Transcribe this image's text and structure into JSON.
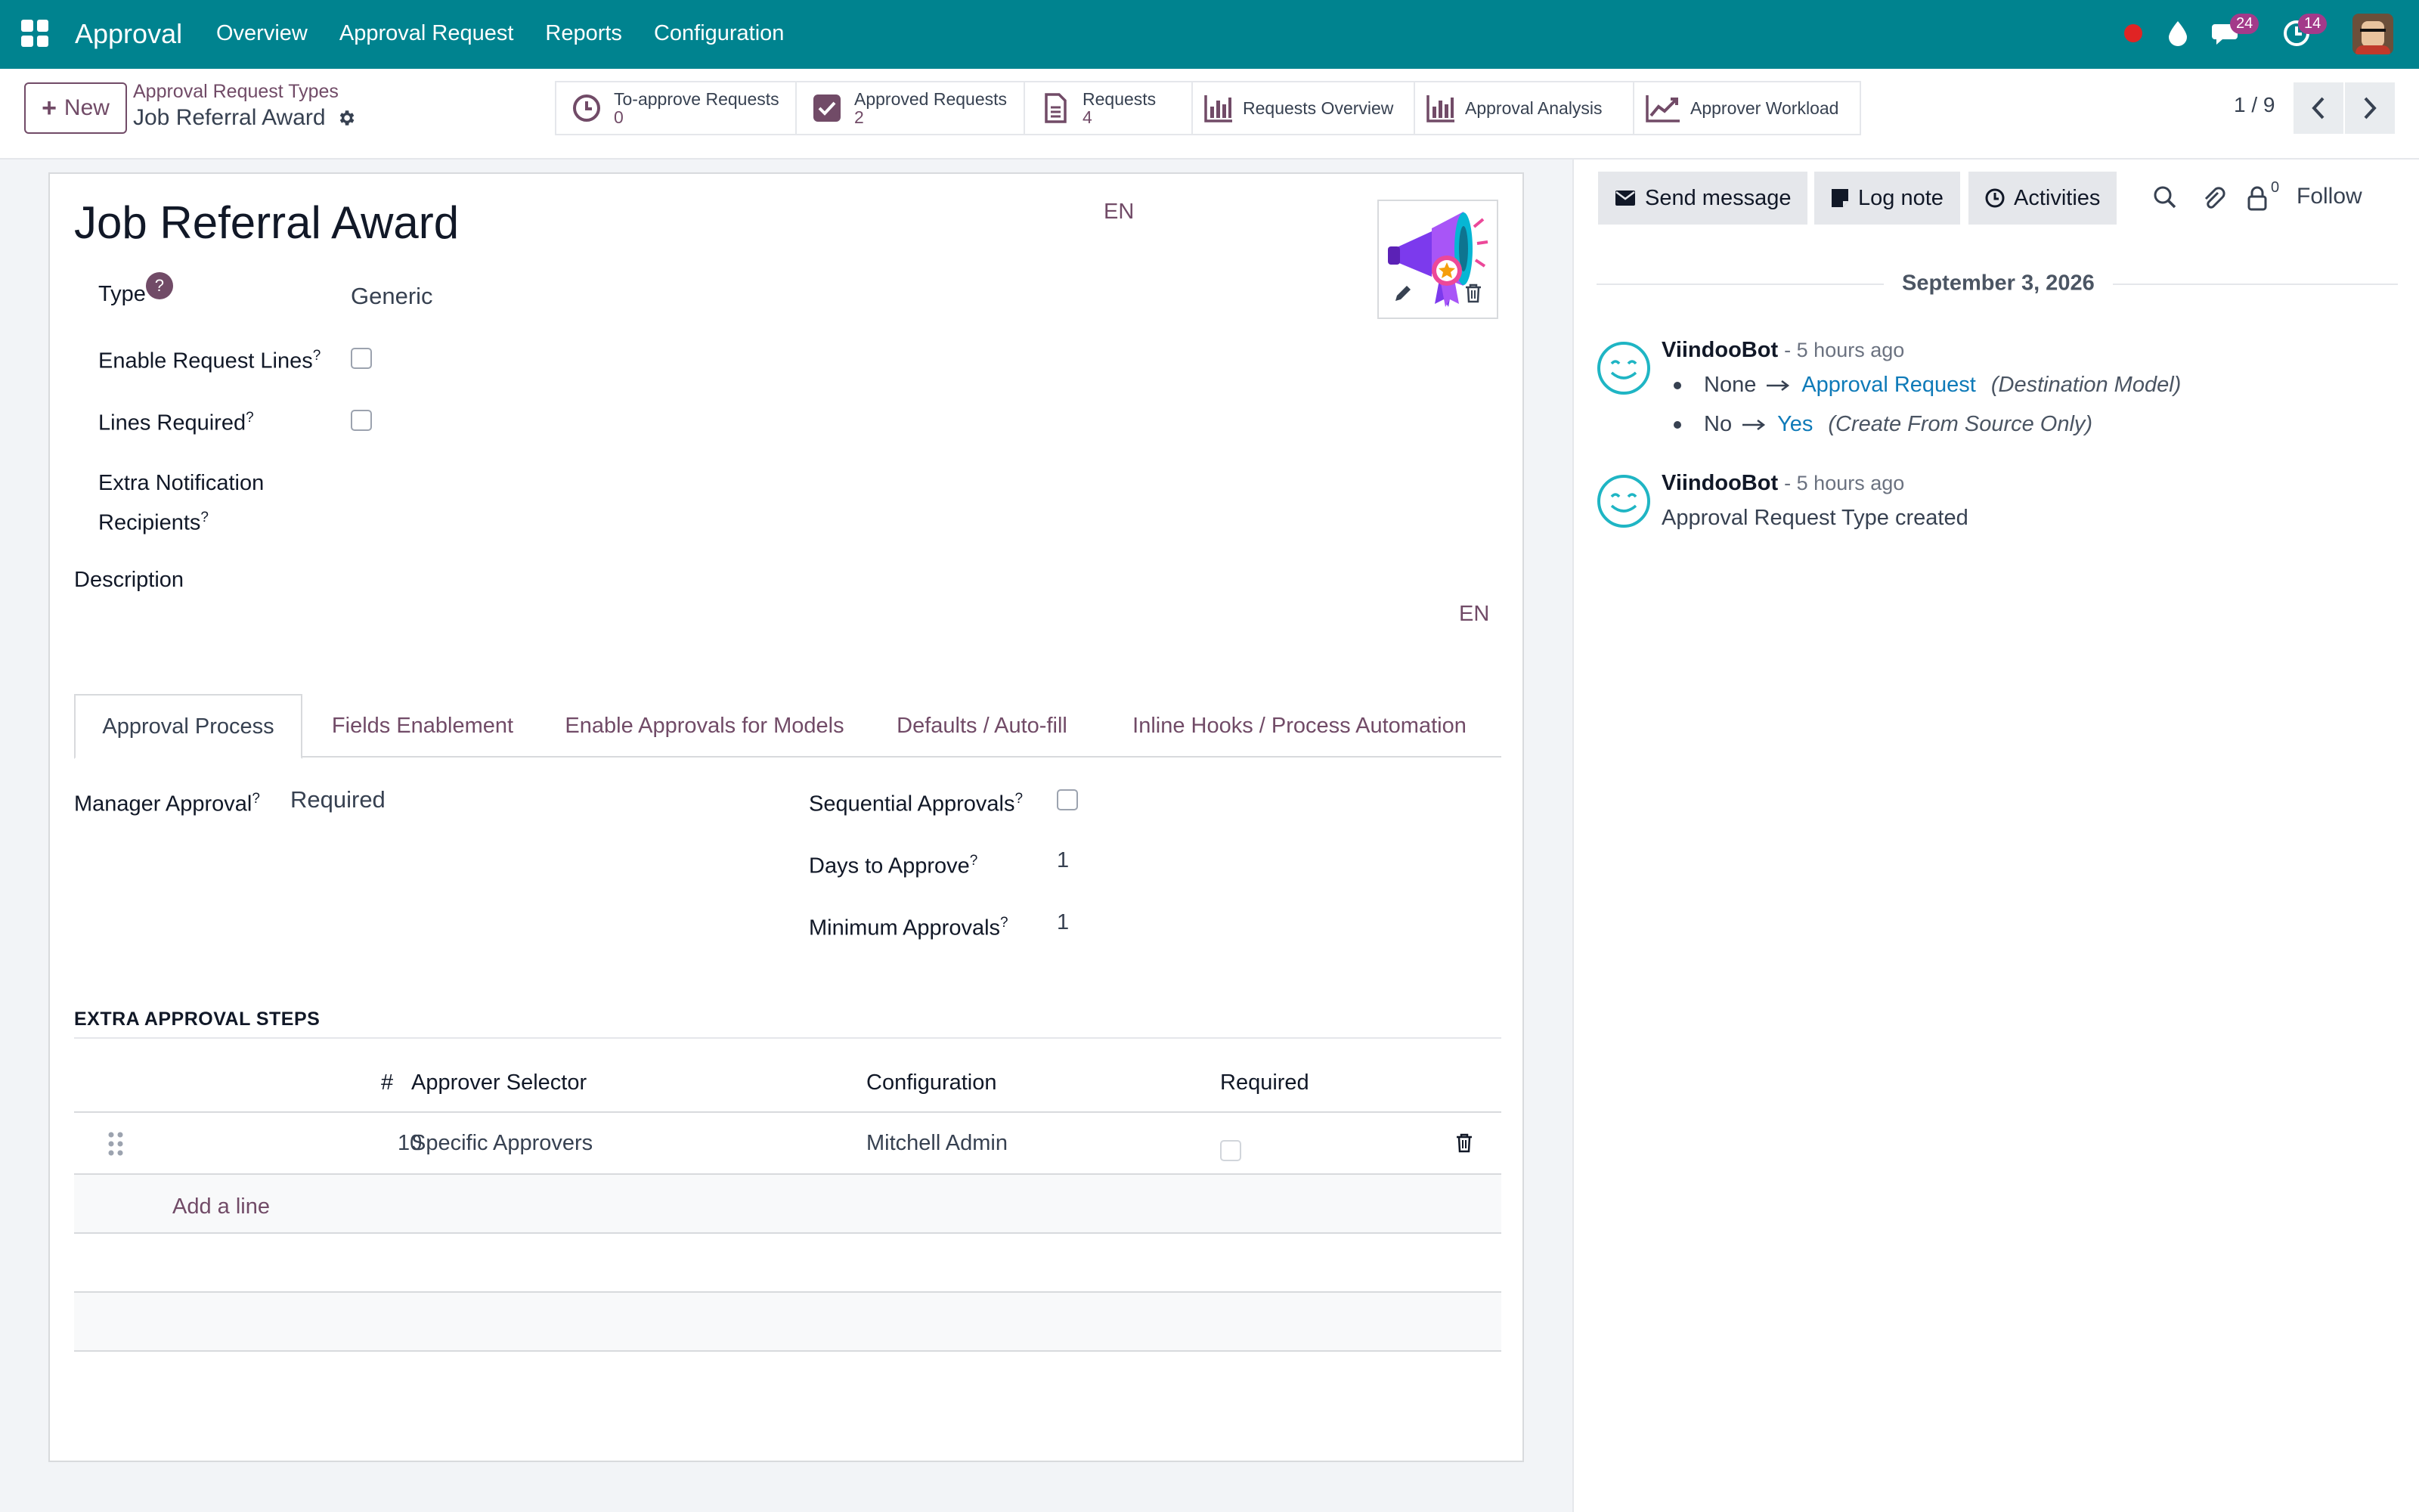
{
  "navbar": {
    "brand": "Approval",
    "menu": [
      "Overview",
      "Approval Request",
      "Reports",
      "Configuration"
    ],
    "chat_count": "24",
    "activity_count": "14"
  },
  "control": {
    "new_label": "New",
    "breadcrumb_parent": "Approval Request Types",
    "breadcrumb_current": "Job Referral Award",
    "smart_buttons": {
      "to_approve": {
        "label": "To-approve Requests",
        "count": "0"
      },
      "approved": {
        "label": "Approved Requests",
        "count": "2"
      },
      "requests": {
        "label": "Requests",
        "count": "4"
      },
      "overview": {
        "label": "Requests Overview"
      },
      "analysis": {
        "label": "Approval Analysis"
      },
      "workload": {
        "label": "Approver Workload"
      }
    },
    "pager": "1 / 9"
  },
  "form": {
    "title": "Job Referral Award",
    "lang": "EN",
    "type_label": "Type",
    "type_help": "?",
    "type_value": "Generic",
    "enable_lines_label": "Enable Request Lines",
    "lines_required_label": "Lines Required",
    "extra_recipients_label_1": "Extra Notification",
    "extra_recipients_label_2": "Recipients",
    "description_label": "Description",
    "description_lang": "EN",
    "help_mark": "?",
    "tabs": [
      "Approval Process",
      "Fields Enablement",
      "Enable Approvals for Models",
      "Defaults / Auto-fill",
      "Inline Hooks / Process Automation"
    ],
    "manager_approval_label": "Manager Approval",
    "manager_approval_value": "Required",
    "sequential_label": "Sequential Approvals",
    "days_label": "Days to Approve",
    "days_value": "1",
    "min_approvals_label": "Minimum Approvals",
    "min_approvals_value": "1",
    "section_title": "EXTRA APPROVAL STEPS",
    "table": {
      "headers": [
        "#",
        "Approver Selector",
        "Configuration",
        "Required"
      ],
      "rows": [
        {
          "seq": "10",
          "selector": "Specific Approvers",
          "configuration": "Mitchell Admin"
        }
      ],
      "add_line": "Add a line"
    }
  },
  "chatter": {
    "send_message": "Send message",
    "log_note": "Log note",
    "activities": "Activities",
    "followers_count": "0",
    "follow": "Follow",
    "date": "September 3, 2026",
    "messages": [
      {
        "author": "ViindooBot",
        "time": "- 5 hours ago",
        "changes": [
          {
            "old": "None",
            "new": "Approval Request",
            "field": "(Destination Model)"
          },
          {
            "old": "No",
            "new": "Yes",
            "field": "(Create From Source Only)"
          }
        ]
      },
      {
        "author": "ViindooBot",
        "time": "- 5 hours ago",
        "body": "Approval Request Type created"
      }
    ]
  },
  "colors": {
    "navbar": "#00838f",
    "primary": "#714b67",
    "link": "#0e7ab8",
    "bot_avatar": "#1fb5c4"
  }
}
